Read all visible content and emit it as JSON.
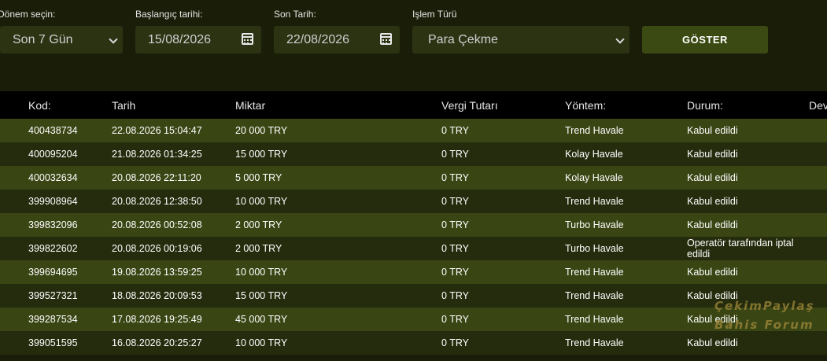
{
  "filters": {
    "period": {
      "label": "Dönem seçin:",
      "value": "Son 7 Gün"
    },
    "start_date": {
      "label": "Başlangıç tarihi:",
      "value": "15/08/2026"
    },
    "end_date": {
      "label": "Son Tarih:",
      "value": "22/08/2026"
    },
    "type": {
      "label": "Işlem Türü",
      "value": "Para Çekme"
    },
    "show_button": "GÖSTER"
  },
  "table": {
    "headers": [
      "Kod:",
      "Tarih",
      "Miktar",
      "Vergi Tutarı",
      "Yöntem:",
      "Durum:",
      "Dev"
    ],
    "rows": [
      {
        "code": "400438734",
        "date": "22.08.2026 15:04:47",
        "amount": "20 000 TRY",
        "tax": "0 TRY",
        "method": "Trend Havale",
        "status": "Kabul edildi"
      },
      {
        "code": "400095204",
        "date": "21.08.2026 01:34:25",
        "amount": "15 000 TRY",
        "tax": "0 TRY",
        "method": "Kolay Havale",
        "status": "Kabul edildi"
      },
      {
        "code": "400032634",
        "date": "20.08.2026 22:11:20",
        "amount": "5 000 TRY",
        "tax": "0 TRY",
        "method": "Kolay Havale",
        "status": "Kabul edildi"
      },
      {
        "code": "399908964",
        "date": "20.08.2026 12:38:50",
        "amount": "10 000 TRY",
        "tax": "0 TRY",
        "method": "Trend Havale",
        "status": "Kabul edildi"
      },
      {
        "code": "399832096",
        "date": "20.08.2026 00:52:08",
        "amount": "2 000 TRY",
        "tax": "0 TRY",
        "method": "Turbo Havale",
        "status": "Kabul edildi"
      },
      {
        "code": "399822602",
        "date": "20.08.2026 00:19:06",
        "amount": "2 000 TRY",
        "tax": "0 TRY",
        "method": "Turbo Havale",
        "status": "Operatör tarafından iptal edildi"
      },
      {
        "code": "399694695",
        "date": "19.08.2026 13:59:25",
        "amount": "10 000 TRY",
        "tax": "0 TRY",
        "method": "Trend Havale",
        "status": "Kabul edildi"
      },
      {
        "code": "399527321",
        "date": "18.08.2026 20:09:53",
        "amount": "15 000 TRY",
        "tax": "0 TRY",
        "method": "Trend Havale",
        "status": "Kabul edildi"
      },
      {
        "code": "399287534",
        "date": "17.08.2026 19:25:49",
        "amount": "45 000 TRY",
        "tax": "0 TRY",
        "method": "Trend Havale",
        "status": "Kabul edildi"
      },
      {
        "code": "399051595",
        "date": "16.08.2026 20:25:27",
        "amount": "10 000 TRY",
        "tax": "0 TRY",
        "method": "Trend Havale",
        "status": "Kabul edildi"
      }
    ]
  },
  "watermark": {
    "line1": "ÇekimPaylaş",
    "line2": "Bahis Forum"
  },
  "colors": {
    "background": "#1a1e08",
    "input_bg": "#2c3313",
    "button_bg": "#3b4a12",
    "header_bg": "#000000",
    "row_odd": "#3a4514",
    "row_even": "#252c0d"
  }
}
